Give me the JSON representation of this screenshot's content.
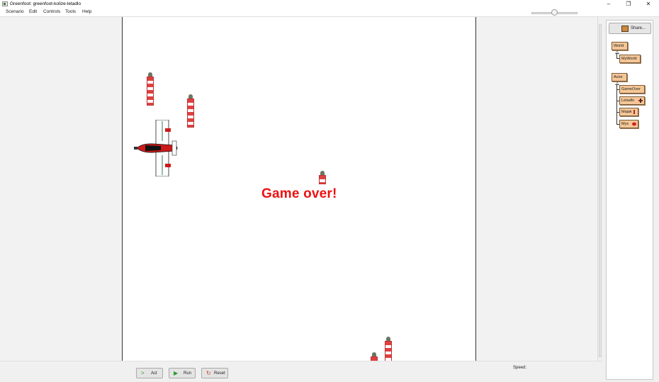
{
  "window": {
    "title": "Greenfoot: greenfoot-kolize-letadlo",
    "minimize": "–",
    "maximize": "❐",
    "close": "✕"
  },
  "menu": {
    "items": [
      {
        "label": "Scenario"
      },
      {
        "label": "Edit"
      },
      {
        "label": "Controls"
      },
      {
        "label": "Tools"
      },
      {
        "label": "Help"
      }
    ]
  },
  "world": {
    "message": "Game over!"
  },
  "panel": {
    "share_label": "Share...",
    "classes": [
      {
        "name": "World"
      },
      {
        "name": "MyWorld"
      },
      {
        "name": "Actor"
      },
      {
        "name": "GameOver"
      },
      {
        "name": "Letadlo"
      },
      {
        "name": "Majak"
      },
      {
        "name": "Mys"
      }
    ]
  },
  "controls": {
    "act_label": "Act",
    "run_label": "Run",
    "reset_label": "Reset",
    "speed_label": "Speed:",
    "speed_value": 0.5
  },
  "colors": {
    "game_over_text": "#ee1111",
    "class_box": "#f5c797",
    "act_icon": "#2a9a2a",
    "run_icon": "#2a9a2a",
    "reset_icon": "#c8401e"
  },
  "icons": {
    "act": "act-arrow-icon",
    "run": "run-play-icon",
    "reset": "reset-icon",
    "share": "share-icon"
  }
}
